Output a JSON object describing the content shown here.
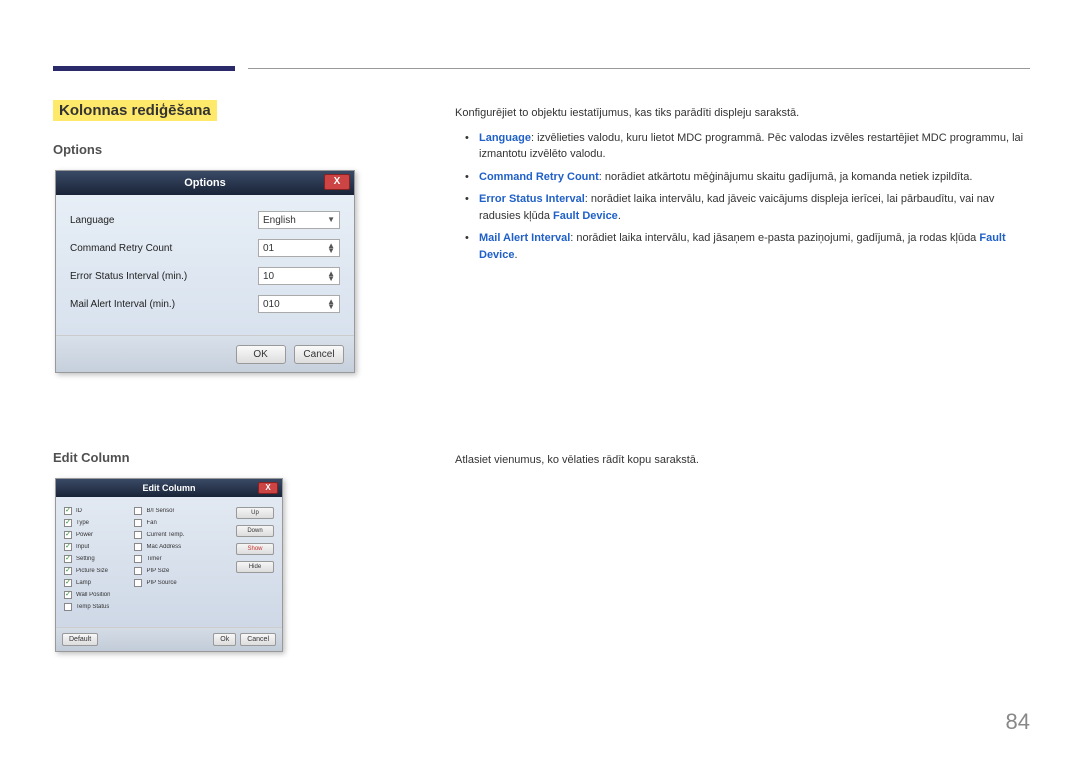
{
  "page_number": "84",
  "section_title": "Kolonnas rediģēšana",
  "headings": {
    "options": "Options",
    "edit_column": "Edit Column"
  },
  "descriptions": {
    "options_intro": "Konfigurējiet to objektu iestatījumus, kas tiks parādīti displeju sarakstā.",
    "bullets": {
      "language_kw": "Language",
      "language_txt": ": izvēlieties valodu, kuru lietot MDC programmā. Pēc valodas izvēles restartējiet MDC programmu, lai izmantotu izvēlēto valodu.",
      "retry_kw": "Command Retry Count",
      "retry_txt": ": norādiet atkārtotu mēģinājumu skaitu gadījumā, ja komanda netiek izpildīta.",
      "error_kw": "Error Status Interval",
      "error_txt_a": ": norādiet laika intervālu, kad jāveic vaicājums displeja ierīcei, lai pārbaudītu, vai nav radusies kļūda ",
      "fault_device_kw": "Fault Device",
      "error_txt_b": ".",
      "mail_kw": "Mail Alert Interval",
      "mail_txt_a": ": norādiet laika intervālu, kad jāsaņem e-pasta paziņojumi, gadījumā, ja rodas kļūda ",
      "mail_txt_b": "."
    },
    "editcol_intro": "Atlasiet vienumus, ko vēlaties rādīt kopu sarakstā."
  },
  "options_dialog": {
    "title": "Options",
    "close": "X",
    "rows": [
      {
        "label": "Language",
        "value": "English",
        "type": "dropdown"
      },
      {
        "label": "Command Retry Count",
        "value": "01",
        "type": "spin"
      },
      {
        "label": "Error Status Interval (min.)",
        "value": "10",
        "type": "spin"
      },
      {
        "label": "Mail Alert Interval (min.)",
        "value": "010",
        "type": "spin"
      }
    ],
    "ok": "OK",
    "cancel": "Cancel"
  },
  "editcol_dialog": {
    "title": "Edit Column",
    "close": "X",
    "col1": [
      {
        "label": "ID",
        "on": true
      },
      {
        "label": "Type",
        "on": true
      },
      {
        "label": "Power",
        "on": true
      },
      {
        "label": "Input",
        "on": true
      },
      {
        "label": "Setting",
        "on": true
      },
      {
        "label": "Picture Size",
        "on": true
      },
      {
        "label": "Lamp",
        "on": true
      },
      {
        "label": "Wall Position",
        "on": true
      },
      {
        "label": "Temp Status",
        "on": false
      }
    ],
    "col2": [
      {
        "label": "B/I Sensor",
        "on": false
      },
      {
        "label": "Fan",
        "on": false
      },
      {
        "label": "Current Temp.",
        "on": false
      },
      {
        "label": "Mac Address",
        "on": false
      },
      {
        "label": "Timer",
        "on": false
      },
      {
        "label": "PIP Size",
        "on": false
      },
      {
        "label": "PIP Source",
        "on": false
      }
    ],
    "side": [
      "Up",
      "Down",
      "Show",
      "Hide"
    ],
    "default": "Default",
    "ok": "Ok",
    "cancel": "Cancel"
  }
}
